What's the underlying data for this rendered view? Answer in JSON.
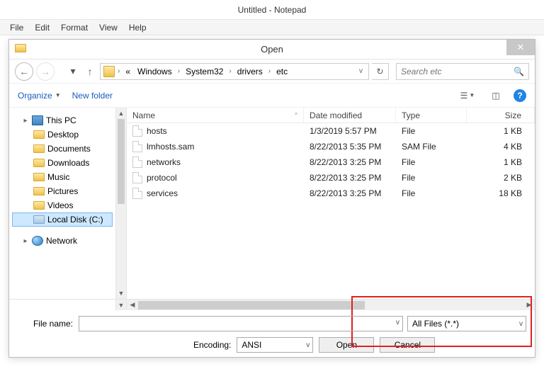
{
  "app": {
    "title": "Untitled - Notepad",
    "menu": [
      "File",
      "Edit",
      "Format",
      "View",
      "Help"
    ]
  },
  "dialog": {
    "title": "Open",
    "breadcrumb": {
      "overflow": "«",
      "items": [
        "Windows",
        "System32",
        "drivers",
        "etc"
      ]
    },
    "search": {
      "placeholder": "Search etc"
    },
    "toolbar": {
      "organize": "Organize",
      "newfolder": "New folder"
    },
    "tree": {
      "root": "This PC",
      "children": [
        "Desktop",
        "Documents",
        "Downloads",
        "Music",
        "Pictures",
        "Videos",
        "Local Disk (C:)"
      ],
      "network": "Network",
      "selected": "Local Disk (C:)"
    },
    "columns": {
      "name": "Name",
      "date": "Date modified",
      "type": "Type",
      "size": "Size"
    },
    "files": [
      {
        "name": "hosts",
        "date": "1/3/2019 5:57 PM",
        "type": "File",
        "size": "1 KB"
      },
      {
        "name": "lmhosts.sam",
        "date": "8/22/2013 5:35 PM",
        "type": "SAM File",
        "size": "4 KB"
      },
      {
        "name": "networks",
        "date": "8/22/2013 3:25 PM",
        "type": "File",
        "size": "1 KB"
      },
      {
        "name": "protocol",
        "date": "8/22/2013 3:25 PM",
        "type": "File",
        "size": "2 KB"
      },
      {
        "name": "services",
        "date": "8/22/2013 3:25 PM",
        "type": "File",
        "size": "18 KB"
      }
    ],
    "footer": {
      "filename_label": "File name:",
      "filename_value": "",
      "filetype": "All Files  (*.*)",
      "encoding_label": "Encoding:",
      "encoding_value": "ANSI",
      "open": "Open",
      "cancel": "Cancel"
    }
  }
}
